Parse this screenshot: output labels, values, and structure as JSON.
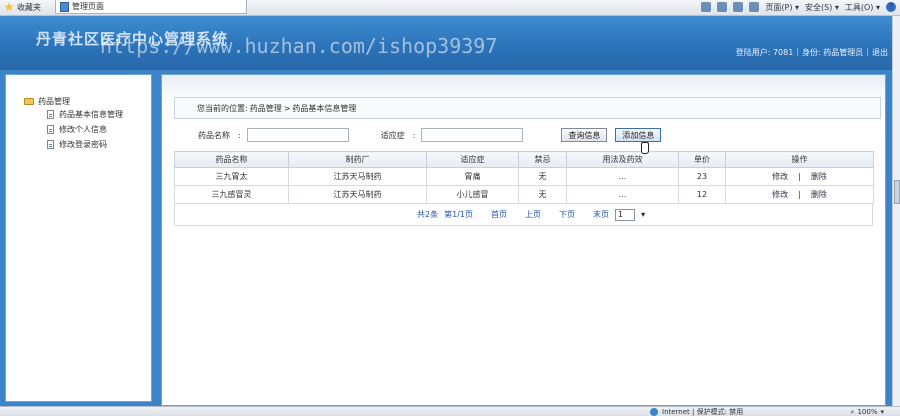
{
  "browser": {
    "favorites_label": "收藏夹",
    "tab_title": "管理页面",
    "menu_page": "页面(P) ▾",
    "menu_safety": "安全(S) ▾",
    "menu_tools": "工具(O) ▾",
    "status_zone": "Internet | 保护模式: 禁用",
    "zoom": "100%"
  },
  "header": {
    "app_title": "丹青社区医疗中心管理系统",
    "watermark": "https://www.huzhan.com/ishop39397",
    "login_user_label": "登陆用户: 7081",
    "role_label": "身份: 药品管理员",
    "logout_label": "退出"
  },
  "sidebar": {
    "root_label": "药品管理",
    "items": [
      {
        "label": "药品基本信息管理"
      },
      {
        "label": "修改个人信息"
      },
      {
        "label": "修改登录密码"
      }
    ]
  },
  "breadcrumb": {
    "prefix": "您当前的位置:",
    "level1": "药品管理",
    "separator": ">",
    "level2": "药品基本信息管理"
  },
  "search": {
    "name_label": "药品名称",
    "indication_label": "适应症",
    "colon": ":",
    "query_button": "查询信息",
    "add_button": "添加信息"
  },
  "table": {
    "columns": [
      "药品名称",
      "制药厂",
      "适应症",
      "禁忌",
      "用法及药效",
      "单价",
      "操作"
    ],
    "rows": [
      {
        "name": "三九胃太",
        "maker": "江苏天马制药",
        "indication": "胃痛",
        "taboo": "无",
        "usage": "...",
        "price": "23"
      },
      {
        "name": "三九感冒灵",
        "maker": "江苏天马制药",
        "indication": "小儿感冒",
        "taboo": "无",
        "usage": "...",
        "price": "12"
      }
    ],
    "edit_label": "修改",
    "ops_sep": "|",
    "delete_label": "删除"
  },
  "pager": {
    "total": "共2条",
    "page_info": "第1/1页",
    "first": "首页",
    "prev": "上页",
    "next": "下页",
    "last": "末页",
    "selected_page": "1"
  }
}
